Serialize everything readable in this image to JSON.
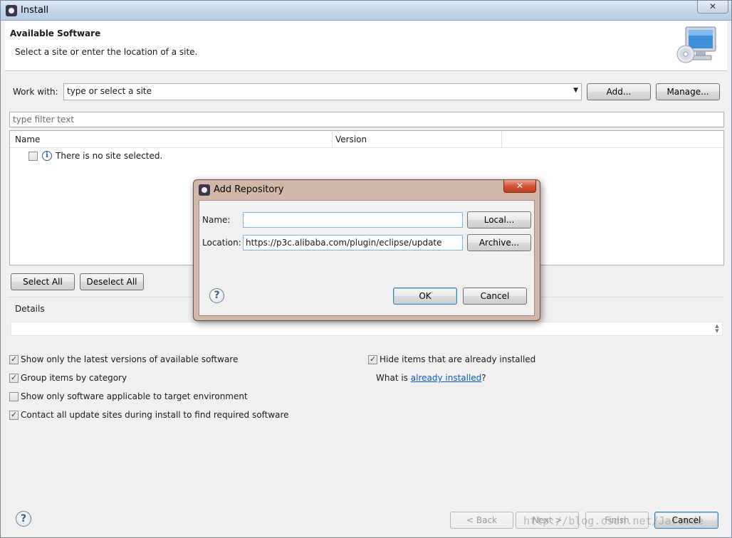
{
  "window": {
    "title": "Install",
    "close_glyph": "✕"
  },
  "banner": {
    "title": "Available Software",
    "description": "Select a site or enter the location of a site."
  },
  "work_with": {
    "label": "Work with:",
    "value": "type or select a site",
    "add_label": "Add...",
    "manage_label": "Manage..."
  },
  "filter": {
    "placeholder": "type filter text"
  },
  "tree": {
    "columns": [
      "Name",
      "Version"
    ],
    "empty_message": "There is no site selected."
  },
  "selection": {
    "select_all": "Select All",
    "deselect_all": "Deselect All"
  },
  "details": {
    "title": "Details"
  },
  "options": {
    "latest_versions": {
      "label": "Show only the latest versions of available software",
      "checked": true
    },
    "group_by_category": {
      "label": "Group items by category",
      "checked": true
    },
    "target_env": {
      "label": "Show only software applicable to target environment",
      "checked": false
    },
    "contact_sites": {
      "label": "Contact all update sites during install to find required software",
      "checked": true
    },
    "hide_installed": {
      "label": "Hide items that are already installed",
      "checked": true
    },
    "what_is_prefix": "What is ",
    "already_installed_link": "already installed",
    "what_is_suffix": "?"
  },
  "footer": {
    "back": "< Back",
    "next": "Next >",
    "finish": "Finish",
    "cancel": "Cancel"
  },
  "watermark": "http://blog.csdn.net/Jarcode",
  "dialog": {
    "title": "Add Repository",
    "close_glyph": "✕",
    "name_label": "Name:",
    "name_value": "",
    "location_label": "Location:",
    "location_value": "https://p3c.alibaba.com/plugin/eclipse/update",
    "local_label": "Local...",
    "archive_label": "Archive...",
    "ok_label": "OK",
    "cancel_label": "Cancel"
  },
  "icons": {
    "app": "eclipse-icon",
    "banner": "monitor-cd-icon",
    "info": "info-icon",
    "help": "help-icon"
  }
}
